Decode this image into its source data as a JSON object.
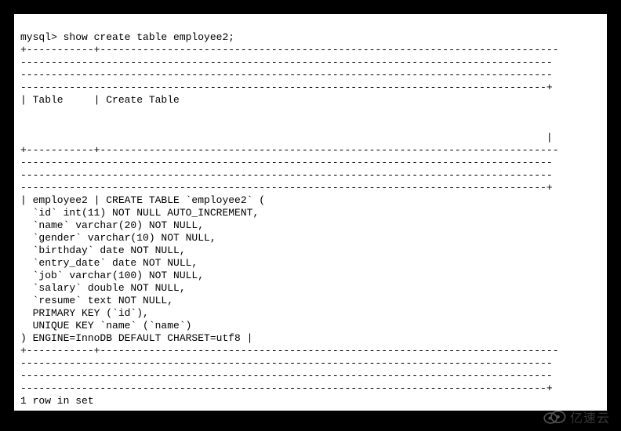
{
  "terminal": {
    "prompt": "mysql> ",
    "command": "show create table employee2;",
    "sep_top1": "+-----------+---------------------------------------------------------------------------",
    "sep_line": "---------------------------------------------------------------------------------------",
    "sep_line_end": "--------------------------------------------------------------------------------------+",
    "header_row": "| Table     | Create Table                                                              ",
    "header_pipe_end": "                                                                                      |",
    "data_open": "| employee2 | CREATE TABLE `employee2` (",
    "col_id": "  `id` int(11) NOT NULL AUTO_INCREMENT,",
    "col_name": "  `name` varchar(20) NOT NULL,",
    "col_gender": "  `gender` varchar(10) NOT NULL,",
    "col_birthday": "  `birthday` date NOT NULL,",
    "col_entry": "  `entry_date` date NOT NULL,",
    "col_job": "  `job` varchar(100) NOT NULL,",
    "col_salary": "  `salary` double NOT NULL,",
    "col_resume": "  `resume` text NOT NULL,",
    "pk": "  PRIMARY KEY (`id`),",
    "uk": "  UNIQUE KEY `name` (`name`)",
    "engine": ") ENGINE=InnoDB DEFAULT CHARSET=utf8 |",
    "footer": "1 row in set"
  },
  "watermark": {
    "text": "亿速云"
  }
}
